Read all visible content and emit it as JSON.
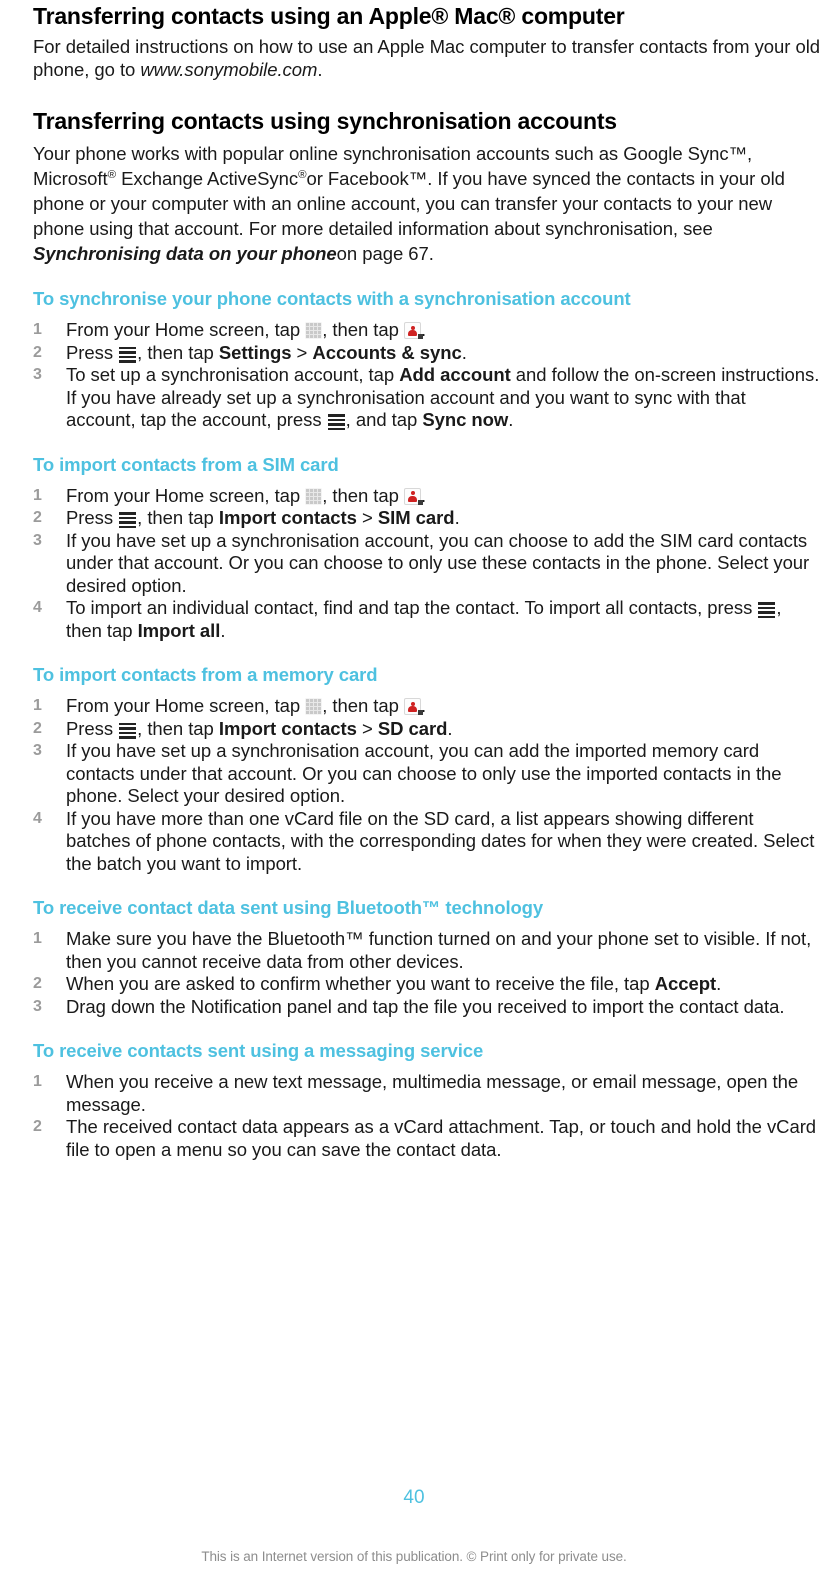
{
  "document": {
    "page_number": "40",
    "disclaimer": "This is an Internet version of this publication. © Print only for private use.",
    "accent_color": "#4ec1e0",
    "step_number_color": "#9b9b9b",
    "text_color": "#1a1a1a"
  },
  "sections": [
    {
      "id": "mac",
      "title": "Transferring contacts using an Apple® Mac® computer",
      "paragraph_parts": {
        "p1": "For detailed instructions on how to use an Apple Mac computer to transfer contacts from your old phone, go to ",
        "p2_italic": "www.sonymobile.com",
        "p3": "."
      }
    },
    {
      "id": "sync",
      "title": "Transferring contacts using synchronisation accounts",
      "paragraph_parts": {
        "p1": "Your phone works with popular online synchronisation accounts such as Google Sync™, Microsoft",
        "sup1": "®",
        "p2": " Exchange ActiveSync",
        "sup2": "®",
        "p3": "or Facebook™. If you have synced the contacts in your old phone or your computer with an online account, you can transfer your contacts to your new phone using that account. For more detailed information about synchronisation, see ",
        "p4_italic_bold": "Synchronising data on your phone",
        "p5": "on page 67."
      }
    }
  ],
  "procedures": [
    {
      "id": "sync-account",
      "title": "To synchronise your phone contacts with a synchronisation account",
      "steps": [
        {
          "num": "1",
          "parts": [
            {
              "type": "text",
              "value": "From your Home screen, tap "
            },
            {
              "type": "icon",
              "value": "app-drawer-grid-icon"
            },
            {
              "type": "text",
              "value": ", then tap "
            },
            {
              "type": "icon",
              "value": "contacts-icon"
            },
            {
              "type": "text",
              "value": "."
            }
          ]
        },
        {
          "num": "2",
          "parts": [
            {
              "type": "text",
              "value": "Press "
            },
            {
              "type": "icon",
              "value": "menu-icon"
            },
            {
              "type": "text",
              "value": ", then tap "
            },
            {
              "type": "bold",
              "value": "Settings"
            },
            {
              "type": "text",
              "value": " > "
            },
            {
              "type": "bold",
              "value": "Accounts & sync"
            },
            {
              "type": "text",
              "value": "."
            }
          ]
        },
        {
          "num": "3",
          "parts": [
            {
              "type": "text",
              "value": "To set up a synchronisation account, tap "
            },
            {
              "type": "bold",
              "value": "Add account"
            },
            {
              "type": "text",
              "value": " and follow the on-screen instructions. If you have already set up a synchronisation account and you want to sync with that account, tap the account, press "
            },
            {
              "type": "icon",
              "value": "menu-icon"
            },
            {
              "type": "text",
              "value": ", and tap "
            },
            {
              "type": "bold",
              "value": "Sync now"
            },
            {
              "type": "text",
              "value": "."
            }
          ]
        }
      ]
    },
    {
      "id": "sim-card",
      "title": "To import contacts from a SIM card",
      "steps": [
        {
          "num": "1",
          "parts": [
            {
              "type": "text",
              "value": "From your Home screen, tap "
            },
            {
              "type": "icon",
              "value": "app-drawer-grid-icon"
            },
            {
              "type": "text",
              "value": ", then tap "
            },
            {
              "type": "icon",
              "value": "contacts-icon"
            },
            {
              "type": "text",
              "value": "."
            }
          ]
        },
        {
          "num": "2",
          "parts": [
            {
              "type": "text",
              "value": "Press "
            },
            {
              "type": "icon",
              "value": "menu-icon"
            },
            {
              "type": "text",
              "value": ", then tap "
            },
            {
              "type": "bold",
              "value": "Import contacts"
            },
            {
              "type": "text",
              "value": " > "
            },
            {
              "type": "bold",
              "value": "SIM card"
            },
            {
              "type": "text",
              "value": "."
            }
          ]
        },
        {
          "num": "3",
          "parts": [
            {
              "type": "text",
              "value": "If you have set up a synchronisation account, you can choose to add the SIM card contacts under that account. Or you can choose to only use these contacts in the phone. Select your desired option."
            }
          ]
        },
        {
          "num": "4",
          "parts": [
            {
              "type": "text",
              "value": "To import an individual contact, find and tap the contact. To import all contacts, press "
            },
            {
              "type": "icon",
              "value": "menu-icon"
            },
            {
              "type": "text",
              "value": ", then tap "
            },
            {
              "type": "bold",
              "value": "Import all"
            },
            {
              "type": "text",
              "value": "."
            }
          ]
        }
      ]
    },
    {
      "id": "memory-card",
      "title": "To import contacts from a memory card",
      "steps": [
        {
          "num": "1",
          "parts": [
            {
              "type": "text",
              "value": "From your Home screen, tap "
            },
            {
              "type": "icon",
              "value": "app-drawer-grid-icon"
            },
            {
              "type": "text",
              "value": ", then tap "
            },
            {
              "type": "icon",
              "value": "contacts-icon"
            },
            {
              "type": "text",
              "value": "."
            }
          ]
        },
        {
          "num": "2",
          "parts": [
            {
              "type": "text",
              "value": "Press "
            },
            {
              "type": "icon",
              "value": "menu-icon"
            },
            {
              "type": "text",
              "value": ", then tap "
            },
            {
              "type": "bold",
              "value": "Import contacts"
            },
            {
              "type": "text",
              "value": " > "
            },
            {
              "type": "bold",
              "value": "SD card"
            },
            {
              "type": "text",
              "value": "."
            }
          ]
        },
        {
          "num": "3",
          "parts": [
            {
              "type": "text",
              "value": "If you have set up a synchronisation account, you can add the imported memory card contacts under that account. Or you can choose to only use the imported contacts in the phone. Select your desired option."
            }
          ]
        },
        {
          "num": "4",
          "parts": [
            {
              "type": "text",
              "value": "If you have more than one vCard file on the SD card, a list appears showing different batches of phone contacts, with the corresponding dates for when they were created. Select the batch you want to import."
            }
          ]
        }
      ]
    },
    {
      "id": "bluetooth",
      "title": "To receive contact data sent using Bluetooth™ technology",
      "steps": [
        {
          "num": "1",
          "parts": [
            {
              "type": "text",
              "value": "Make sure you have the Bluetooth™ function turned on and your phone set to visible. If not, then you cannot receive data from other devices."
            }
          ]
        },
        {
          "num": "2",
          "parts": [
            {
              "type": "text",
              "value": "When you are asked to confirm whether you want to receive the file, tap "
            },
            {
              "type": "bold",
              "value": "Accept"
            },
            {
              "type": "text",
              "value": "."
            }
          ]
        },
        {
          "num": "3",
          "parts": [
            {
              "type": "text",
              "value": "Drag down the Notification panel and tap the file you received to import the contact data."
            }
          ]
        }
      ]
    },
    {
      "id": "messaging",
      "title": "To receive contacts sent using a messaging service",
      "steps": [
        {
          "num": "1",
          "parts": [
            {
              "type": "text",
              "value": "When you receive a new text message, multimedia message, or email message, open the message."
            }
          ]
        },
        {
          "num": "2",
          "parts": [
            {
              "type": "text",
              "value": "The received contact data appears as a vCard attachment. Tap, or touch and hold the vCard file to open a menu so you can save the contact data."
            }
          ]
        }
      ]
    }
  ]
}
